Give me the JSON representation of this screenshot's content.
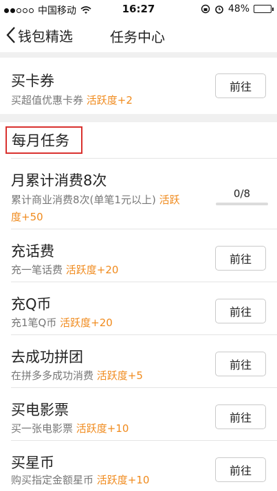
{
  "status_bar": {
    "carrier": "中国移动",
    "time": "16:27",
    "battery": "48%",
    "battery_level": 0.48
  },
  "nav": {
    "back_label": "钱包精选",
    "title": "任务中心"
  },
  "top_task": {
    "title": "买卡券",
    "desc": "买超值优惠卡券",
    "reward": "活跃度+2",
    "button": "前往"
  },
  "section": {
    "title": "每月任务"
  },
  "progress_task": {
    "title": "月累计消费8次",
    "desc_line1": "累计商业消费8次(单笔1元以上) ",
    "reward_line1": "活跃",
    "reward_line2": "度+50",
    "progress_text": "0/8",
    "progress_value": 0
  },
  "tasks": [
    {
      "title": "充话费",
      "desc": "充一笔话费",
      "reward": "活跃度+20",
      "button": "前往"
    },
    {
      "title": "充Q币",
      "desc": "充1笔Q币",
      "reward": "活跃度+20",
      "button": "前往"
    },
    {
      "title": "去成功拼团",
      "desc": "在拼多多成功消费",
      "reward": "活跃度+5",
      "button": "前往"
    },
    {
      "title": "买电影票",
      "desc": "买一张电影票",
      "reward": "活跃度+10",
      "button": "前往"
    },
    {
      "title": "买星币",
      "desc": "购买指定金额星币",
      "reward": "活跃度+10",
      "button": "前往"
    }
  ]
}
